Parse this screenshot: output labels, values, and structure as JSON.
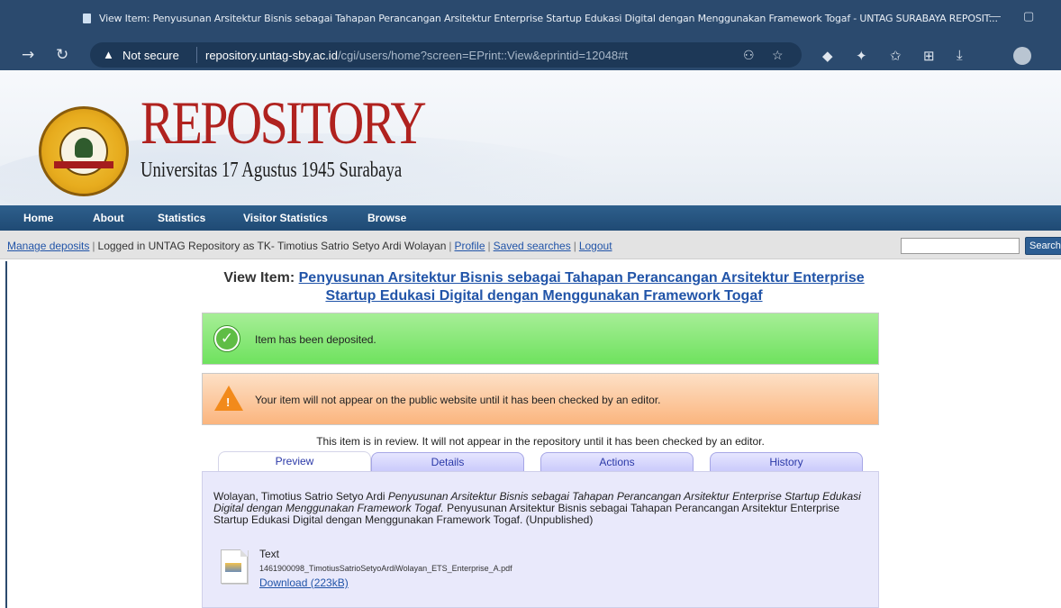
{
  "browser": {
    "tab_title": "View Item: Penyusunan Arsitektur Bisnis sebagai Tahapan Perancangan Arsitektur Enterprise Startup Edukasi Digital dengan Menggunakan Framework Togaf - UNTAG SURABAYA REPOSIT...",
    "not_secure_label": "Not secure",
    "url_host": "repository.untag-sby.ac.id",
    "url_path": "/cgi/users/home?screen=EPrint::View&eprintid=12048#t"
  },
  "header": {
    "logo_title": "REPOSITORY",
    "logo_subtitle": "Universitas 17 Agustus 1945 Surabaya"
  },
  "nav": {
    "items": [
      "Home",
      "About",
      "Statistics",
      "Visitor Statistics",
      "Browse"
    ]
  },
  "userbar": {
    "manage_deposits": "Manage deposits",
    "logged_in_text": "Logged in UNTAG Repository as TK- Timotius Satrio Setyo Ardi Wolayan",
    "profile": "Profile",
    "saved_searches": "Saved searches",
    "logout": "Logout",
    "search_button": "Search"
  },
  "page": {
    "title_prefix": "View Item:",
    "title_line1": "Penyusunan Arsitektur Bisnis sebagai Tahapan Perancangan Arsitektur Enterprise",
    "title_line2": "Startup Edukasi Digital dengan Menggunakan Framework Togaf",
    "msg_ok": "Item has been deposited.",
    "msg_warn": "Your item will not appear on the public website until it has been checked by an editor.",
    "review_note": "This item is in review. It will not appear in the repository until it has been checked by an editor."
  },
  "tabs": [
    "Preview",
    "Details",
    "Actions",
    "History"
  ],
  "preview": {
    "author": "Wolayan, Timotius Satrio Setyo Ardi",
    "title_italic": "Penyusunan Arsitektur Bisnis sebagai Tahapan Perancangan Arsitektur Enterprise Startup Edukasi Digital dengan Menggunakan Framework Togaf.",
    "title_plain": "Penyusunan Arsitektur Bisnis sebagai Tahapan Perancangan Arsitektur Enterprise Startup Edukasi Digital dengan Menggunakan Framework Togaf. (Unpublished)",
    "file_type": "Text",
    "file_name": "1461900098_TimotiusSatrioSetyoArdiWolayan_ETS_Enterprise_A.pdf",
    "download_label": "Download (223kB)"
  },
  "colors": {
    "accent": "#2154a8",
    "nav_bg": "#1f4a74",
    "success_bg": "#6fe25e",
    "warn_bg": "#fbb57e"
  }
}
